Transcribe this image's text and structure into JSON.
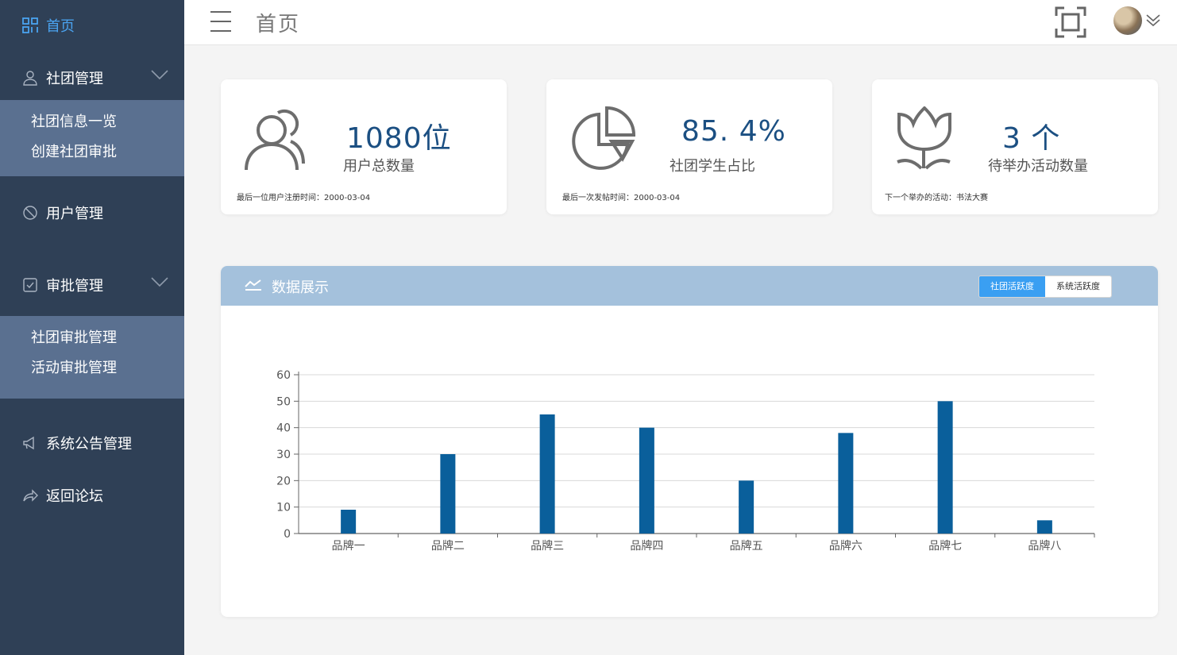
{
  "sidebar": {
    "home": "首页",
    "club_mgmt": "社团管理",
    "club_sub": [
      "社团信息一览",
      "创建社团审批"
    ],
    "user_mgmt": "用户管理",
    "approval_mgmt": "审批管理",
    "approval_sub": [
      "社团审批管理",
      "活动审批管理"
    ],
    "notice_mgmt": "系统公告管理",
    "back_forum": "返回论坛"
  },
  "header": {
    "title": "首页"
  },
  "cards": [
    {
      "value": "1080位",
      "label": "用户总数量",
      "foot": "最后一位用户注册时间：2000-03-04"
    },
    {
      "value": "85. 4%",
      "label": "社团学生占比",
      "foot": "最后一次发帖时间：2000-03-04"
    },
    {
      "value": "3  个",
      "label": "待举办活动数量",
      "foot": "下一个举办的活动：书法大赛"
    }
  ],
  "panel": {
    "title": "数据展示",
    "tabs": [
      "社团活跃度",
      "系统活跃度"
    ]
  },
  "colors": {
    "sidebar": "#2f4056",
    "accent": "#4aa3f0",
    "bar": "#0a5f9b",
    "panel_head": "#a4c1dc"
  },
  "chart_data": {
    "type": "bar",
    "categories": [
      "品牌一",
      "品牌二",
      "品牌三",
      "品牌四",
      "品牌五",
      "品牌六",
      "品牌七",
      "品牌八"
    ],
    "values": [
      9,
      30,
      45,
      40,
      20,
      38,
      50,
      5
    ],
    "ylim": [
      0,
      60
    ],
    "yticks": [
      0,
      10,
      20,
      30,
      40,
      50,
      60
    ],
    "grid": true
  }
}
